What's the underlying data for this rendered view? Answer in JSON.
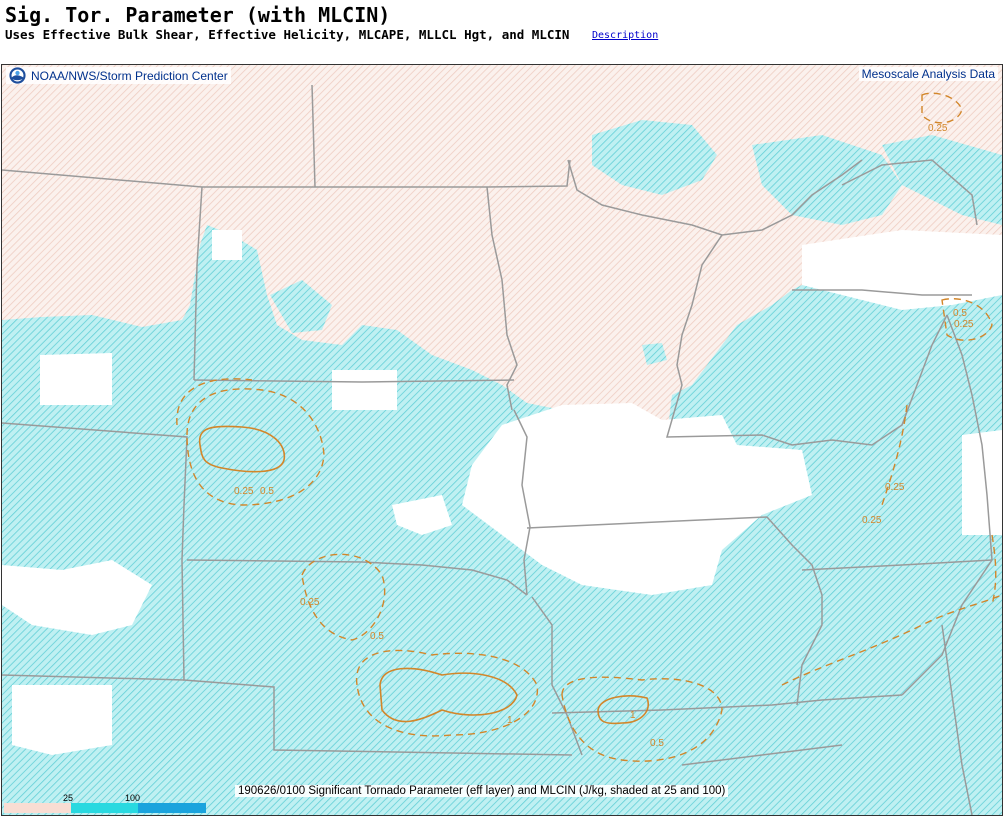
{
  "header": {
    "title": "Sig. Tor. Parameter (with MLCIN)",
    "subtitle": "Uses Effective Bulk Shear, Effective Helicity, MLCAPE, MLLCL Hgt, and MLCIN",
    "description_link": "Description"
  },
  "map": {
    "source_label": "NOAA/NWS/Storm Prediction Center",
    "product_label": "Mesoscale Analysis Data",
    "caption": "190626/0100 Significant Tornado Parameter (eff layer) and MLCIN (J/kg, shaded at 25 and 100)",
    "contour_labels": [
      "0.25",
      "0.25",
      "0.5",
      "0.25",
      "0.5",
      "1",
      "0.25",
      "0.25",
      "0.25",
      "0.5",
      "1",
      "0.5"
    ],
    "colors": {
      "cin_light": "#f6e3dc",
      "cin_25": "#29d9e0",
      "cin_100": "#1aa3dd",
      "contour": "#d2862a",
      "borders": "#9a9a9a",
      "header_text": "#00308c"
    }
  },
  "legend": {
    "ticks": [
      "25",
      "100"
    ],
    "colors": [
      "#f9ddd3",
      "#29d9e0",
      "#1aa3dd"
    ]
  }
}
